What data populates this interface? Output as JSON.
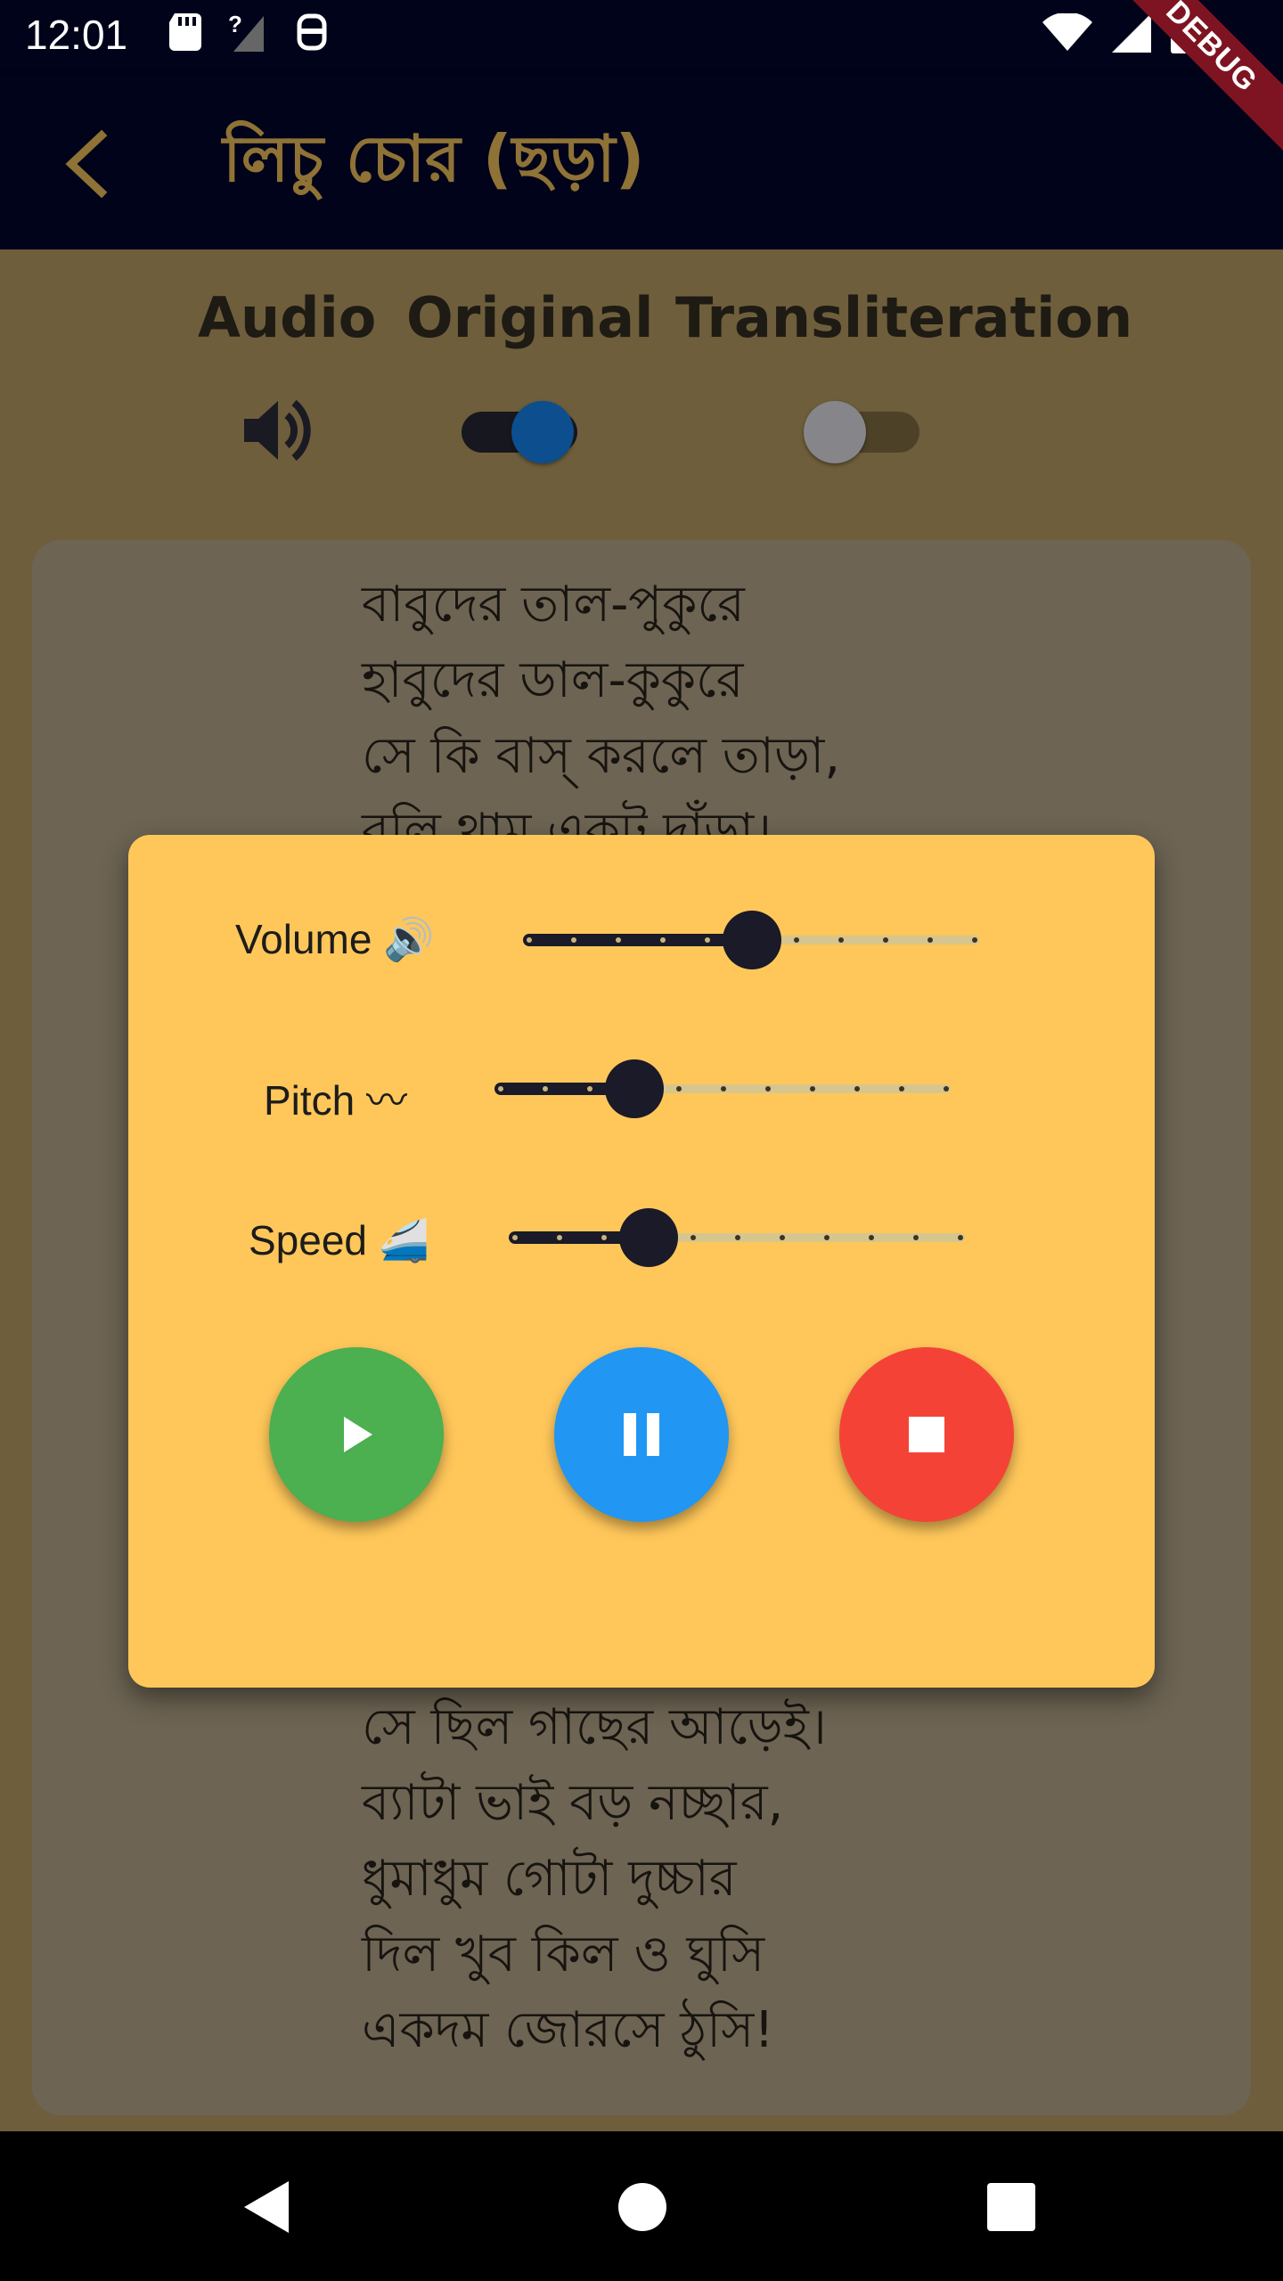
{
  "status_bar": {
    "time": "12:01",
    "icons": [
      "sd-card-icon",
      "no-signal-icon",
      "vpn-icon",
      "wifi-icon",
      "cell-signal-icon",
      "battery-icon"
    ]
  },
  "debug_banner": "DEBUG",
  "app_bar": {
    "title": "লিচু চোর (ছড়া)",
    "back_icon": "back-arrow-icon",
    "color": "#8f7236"
  },
  "tabs": {
    "audio": "Audio",
    "original": "Original",
    "transliteration": "Transliteration"
  },
  "toggles": {
    "original_on": true,
    "transliteration_on": false
  },
  "poem": {
    "top_lines": [
      "বাবুদের তাল-পুকুরে",
      "হাবুদের ডাল-কুকুরে",
      "সে কি বাস্ করলে তাড়া,",
      "বলি থাম একটু দাঁড়া।"
    ],
    "bottom_lines": [
      "সে ছিল গাছের আড়েই।",
      "ব্যাটা ভাই বড় নচ্ছার,",
      "ধুমাধুম গোটা দুচ্চার",
      "দিল খুব কিল ও ঘুসি",
      "একদম জোরসে ঠুসি!"
    ]
  },
  "audio_dialog": {
    "volume_label": "Volume 🔊",
    "pitch_label": "Pitch 〰",
    "speed_label": "Speed 🚄",
    "volume_value": 0.5,
    "pitch_value": 0.3,
    "speed_value": 0.3,
    "play_color": "#4caf50",
    "pause_color": "#2196f3",
    "stop_color": "#f44336"
  },
  "colors": {
    "dialog_bg": "#ffc75a",
    "slider_active": "#1a1a28",
    "slider_inactive": "#d7c58e"
  }
}
